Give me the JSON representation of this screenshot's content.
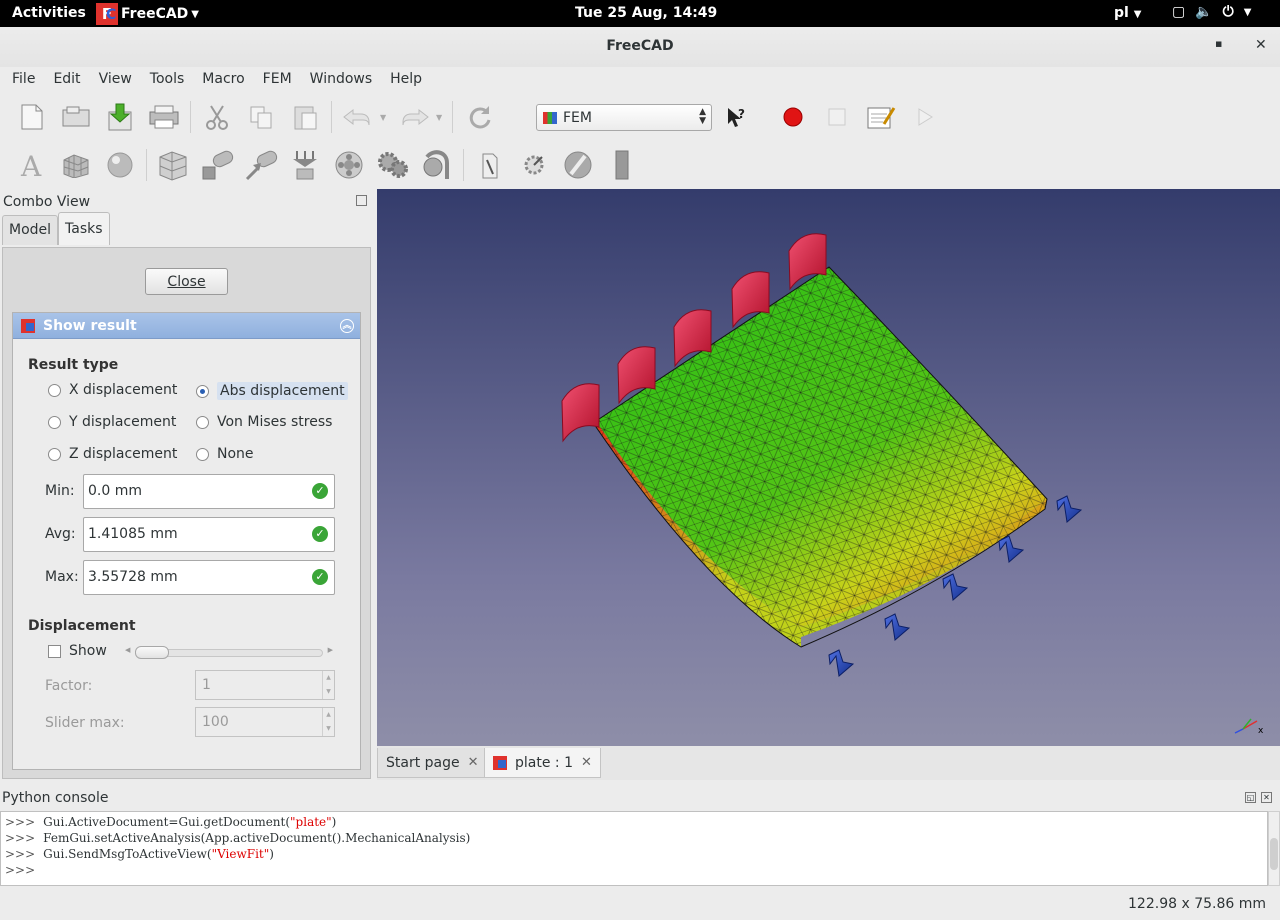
{
  "topbar": {
    "activities": "Activities",
    "app": "FreeCAD",
    "clock": "Tue 25 Aug, 14:49",
    "lang": "pl"
  },
  "window": {
    "title": "FreeCAD"
  },
  "menu": [
    "File",
    "Edit",
    "View",
    "Tools",
    "Macro",
    "FEM",
    "Windows",
    "Help"
  ],
  "workbench": {
    "selected": "FEM"
  },
  "combo": {
    "title": "Combo View",
    "tabs": {
      "model": "Model",
      "tasks": "Tasks"
    },
    "close_label": "Close",
    "show_result": {
      "title": "Show result",
      "result_type_label": "Result type",
      "options": {
        "x": "X displacement",
        "abs": "Abs displacement",
        "y": "Y displacement",
        "vm": "Von Mises stress",
        "z": "Z displacement",
        "none": "None"
      },
      "selected": "Abs displacement",
      "min_label": "Min:",
      "min_value": "0.0 mm",
      "avg_label": "Avg:",
      "avg_value": "1.41085 mm",
      "max_label": "Max:",
      "max_value": "3.55728 mm",
      "displacement_label": "Displacement",
      "show_label": "Show",
      "show_checked": false,
      "slider_value": 0,
      "factor_label": "Factor:",
      "factor_value": "1",
      "slider_max_label": "Slider max:",
      "slider_max_value": "100"
    }
  },
  "doc_tabs": {
    "start": "Start page",
    "plate": "plate : 1"
  },
  "python_console": {
    "title": "Python console",
    "lines": [
      {
        "prompt": ">>>",
        "pre": "Gui.ActiveDocument=Gui.getDocument(",
        "str": "\"plate\"",
        "post": ")"
      },
      {
        "prompt": ">>>",
        "pre": "FemGui.setActiveAnalysis(App.activeDocument().MechanicalAnalysis)",
        "str": "",
        "post": ""
      },
      {
        "prompt": ">>>",
        "pre": "Gui.SendMsgToActiveView(",
        "str": "\"ViewFit\"",
        "post": ")"
      },
      {
        "prompt": ">>>",
        "pre": "",
        "str": "",
        "post": ""
      }
    ]
  },
  "status": {
    "dimensions": "122.98 x 75.86 mm"
  },
  "colors": {
    "fixed_constraint": "#d81f3c",
    "force_arrow": "#1f3fa8",
    "mesh_low": "#2fbf16",
    "mesh_high": "#e23418"
  }
}
